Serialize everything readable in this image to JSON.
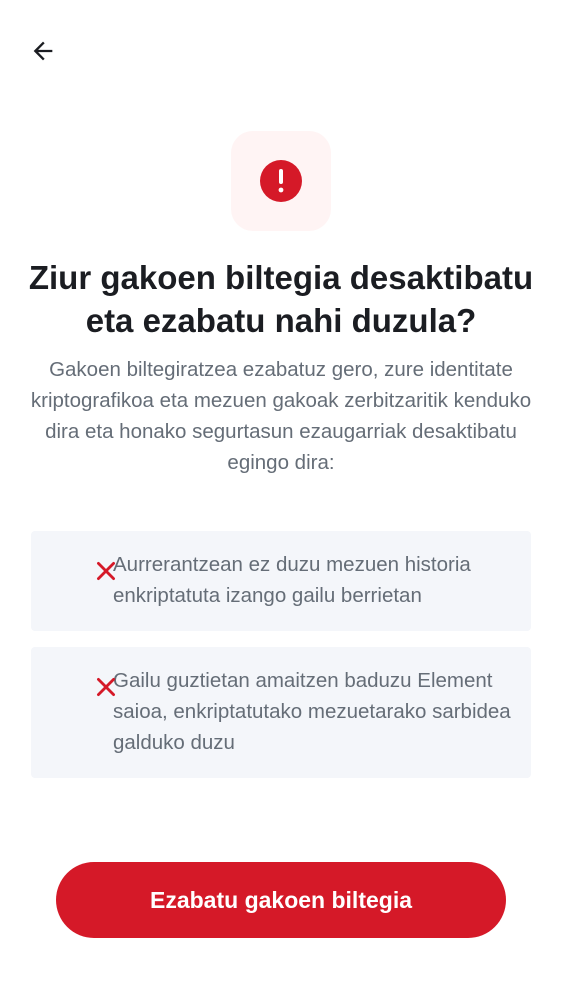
{
  "nav": {
    "back_icon": "arrow-left-icon"
  },
  "hero": {
    "icon": "error-circle-icon",
    "icon_bg_color": "#fff4f4",
    "icon_color": "#d51928"
  },
  "dialog": {
    "title": "Ziur gakoen biltegia desaktibatu eta ezabatu nahi duzula?",
    "description": "Gakoen biltegiratzea ezabatuz gero, zure identitate kriptografikoa eta mezuen gakoak zerbitzaritik kenduko dira eta honako segurtasun ezaugarriak desaktibatu egingo dira:"
  },
  "consequences": [
    {
      "icon": "close-x-icon",
      "text": "Aurrerantzean ez duzu mezuen historia enkriptatuta izango gailu berrietan"
    },
    {
      "icon": "close-x-icon",
      "text": "Gailu guztietan amaitzen baduzu Element saioa, enkriptatutako mezuetarako sarbidea galduko duzu"
    }
  ],
  "actions": {
    "confirm_label": "Ezabatu gakoen biltegia",
    "confirm_color": "#d51928"
  }
}
